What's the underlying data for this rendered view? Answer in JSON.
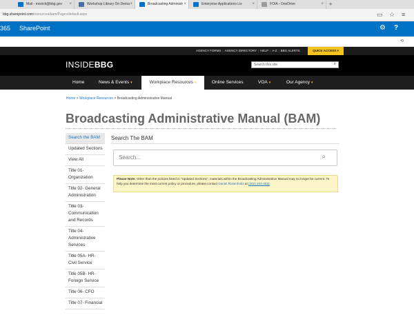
{
  "browser": {
    "tabs": [
      {
        "title": "Mail - mozick@bbg.gov",
        "color": "#0072c6"
      },
      {
        "title": "Workshop Library On Dema",
        "color": "#4a6fa5"
      },
      {
        "title": "Broadcasting Administr",
        "color": "#0072c6",
        "active": true
      },
      {
        "title": "Enterprise Applications Lis",
        "color": "#0072c6"
      },
      {
        "title": "FOIA - OneDrive",
        "color": "#9b9b9b"
      }
    ],
    "new_tab": "+",
    "url_domain": "bbg.sharepoint.com",
    "url_path": "/resources/bam/Pages/default.aspx",
    "url_prefix": ""
  },
  "suite": {
    "o365": "365",
    "app": "SharePoint",
    "gear": "⚙",
    "help": "?"
  },
  "ribbon": {
    "share": "⟲"
  },
  "utility": {
    "links": [
      "AGENCY FORMS",
      "AGENCY DIRECTORY",
      "HELP",
      "A-Z",
      "BBG ALERTS"
    ],
    "quick_access": "QUICK ACCESS ▾"
  },
  "header": {
    "logo_inside": "INSIDE",
    "logo_bbg": "BBG",
    "search_placeholder": "Search this site"
  },
  "nav": {
    "items": [
      {
        "label": "Home",
        "caret": ""
      },
      {
        "label": "News & Events",
        "caret": "▾"
      },
      {
        "label": "Workplace Resources",
        "caret": "▾"
      },
      {
        "label": "Online Services",
        "caret": ""
      },
      {
        "label": "VOA",
        "caret": "▾"
      },
      {
        "label": "Our Agency",
        "caret": "▾"
      }
    ]
  },
  "breadcrumb": {
    "home": "Home",
    "sep": ">",
    "section": "Workplace Resources",
    "current": "Broadcasting Administrative Manual"
  },
  "page_title": "Broadcasting Administrative Manual (BAM)",
  "left_nav": [
    "Search the BAM",
    "Updated Sections",
    "View All",
    "Title 01- Organization",
    "Title 02- General Administration",
    "Title 03- Communication and Records",
    "Title 04- Administrative Services",
    "Title 05A- HR- Civil Service",
    "Title 05B- HR- Foreign Service",
    "Title 06- CFO",
    "Title 07- Financial"
  ],
  "search_section": {
    "title": "Search The BAM",
    "placeholder": "Search..."
  },
  "notice": {
    "label": "Please Note:",
    "text1": " Other than the policies listed in \"Updated Sections\", materials within the Broadcasting Administrative Manual may no longer be current. To help you determine the most current policy or procedure, please contact ",
    "contact": "Daniel Rosenholtz",
    "text2": " at ",
    "phone": "(202) 203-4011"
  }
}
